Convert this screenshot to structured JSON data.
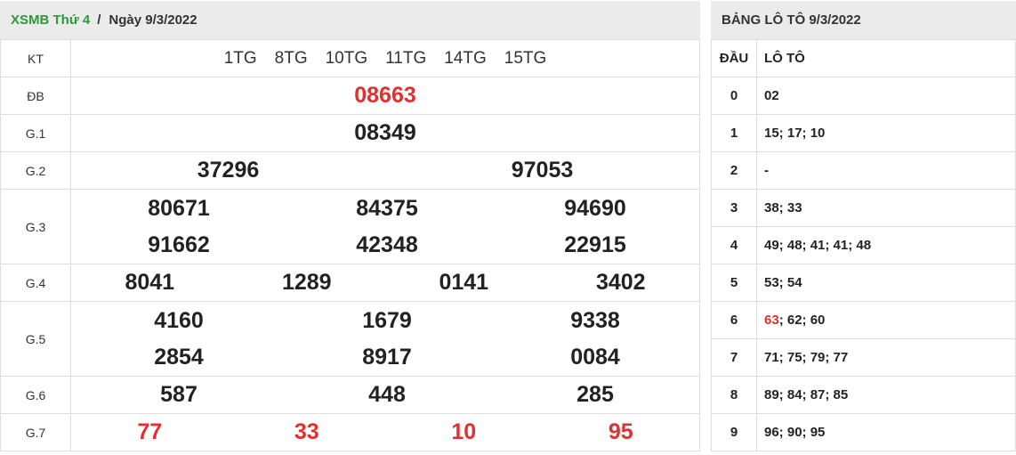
{
  "header": {
    "brand": "XSMB Thứ 4",
    "separator": "/",
    "date": "Ngày 9/3/2022"
  },
  "results": {
    "kt_label": "KT",
    "kt": [
      "1TG",
      "8TG",
      "10TG",
      "11TG",
      "14TG",
      "15TG"
    ],
    "db_label": "ĐB",
    "db": "08663",
    "g1_label": "G.1",
    "g1": "08349",
    "g2_label": "G.2",
    "g2": [
      "37296",
      "97053"
    ],
    "g3_label": "G.3",
    "g3": [
      "80671",
      "84375",
      "94690",
      "91662",
      "42348",
      "22915"
    ],
    "g4_label": "G.4",
    "g4": [
      "8041",
      "1289",
      "0141",
      "3402"
    ],
    "g5_label": "G.5",
    "g5": [
      "4160",
      "1679",
      "9338",
      "2854",
      "8917",
      "0084"
    ],
    "g6_label": "G.6",
    "g6": [
      "587",
      "448",
      "285"
    ],
    "g7_label": "G.7",
    "g7": [
      "77",
      "33",
      "10",
      "95"
    ]
  },
  "loto": {
    "title": "BẢNG LÔ TÔ 9/3/2022",
    "col_dau": "ĐẦU",
    "col_loto": "LÔ TÔ",
    "rows": [
      {
        "dau": "0",
        "pre": "",
        "hl": "",
        "rest": "02"
      },
      {
        "dau": "1",
        "pre": "",
        "hl": "",
        "rest": "15; 17; 10"
      },
      {
        "dau": "2",
        "pre": "",
        "hl": "",
        "rest": "-"
      },
      {
        "dau": "3",
        "pre": "",
        "hl": "",
        "rest": "38; 33"
      },
      {
        "dau": "4",
        "pre": "",
        "hl": "",
        "rest": "49; 48; 41; 41; 48"
      },
      {
        "dau": "5",
        "pre": "",
        "hl": "",
        "rest": "53; 54"
      },
      {
        "dau": "6",
        "pre": "",
        "hl": "63",
        "rest": "; 62; 60"
      },
      {
        "dau": "7",
        "pre": "",
        "hl": "",
        "rest": "71; 75; 79; 77"
      },
      {
        "dau": "8",
        "pre": "",
        "hl": "",
        "rest": "89; 84; 87; 85"
      },
      {
        "dau": "9",
        "pre": "",
        "hl": "",
        "rest": "96; 90; 95"
      }
    ]
  },
  "colors": {
    "highlight_red": "#e03030",
    "brand_green": "#2a9a3a",
    "header_bg": "#ebebeb"
  }
}
